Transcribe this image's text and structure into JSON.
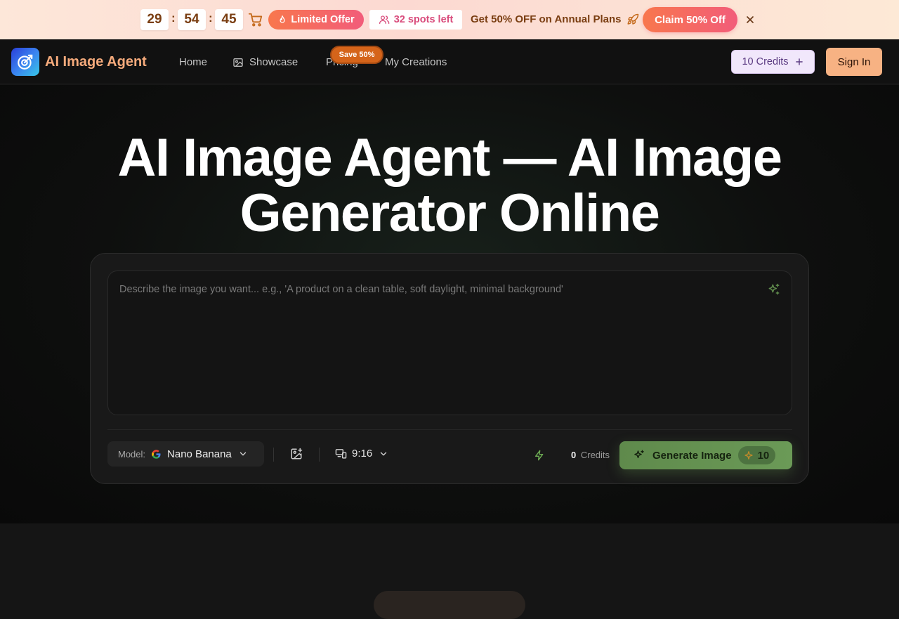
{
  "promo": {
    "timer": {
      "minutes": "29",
      "seconds": "54",
      "centis": "45",
      "sep": ":"
    },
    "offer_label": "Limited Offer",
    "spots_label": "32 spots left",
    "headline": "Get 50% OFF on Annual Plans",
    "claim_label": "Claim 50% Off",
    "colors": {
      "accent_from": "#f8774d",
      "accent_to": "#f25c7a"
    }
  },
  "nav": {
    "brand": "AI Image Agent",
    "links": {
      "home": "Home",
      "showcase": "Showcase",
      "pricing": "Pricing",
      "creations": "My Creations"
    },
    "pricing_badge": "Save 50%",
    "credits_label": "10 Credits",
    "signin_label": "Sign In"
  },
  "hero": {
    "title_line1": "AI Image Agent — AI Image",
    "title_line2": "Generator Online"
  },
  "generator": {
    "prompt_placeholder": "Describe the image you want... e.g., 'A product on a clean table, soft daylight, minimal background'",
    "model_label": "Model:",
    "model_value": "Nano Banana",
    "aspect_ratio": "9:16",
    "credits_count": "0",
    "credits_label": "Credits",
    "generate_label": "Generate Image",
    "generate_cost": "10",
    "colors": {
      "generate_bg": "#6b9a57"
    }
  }
}
